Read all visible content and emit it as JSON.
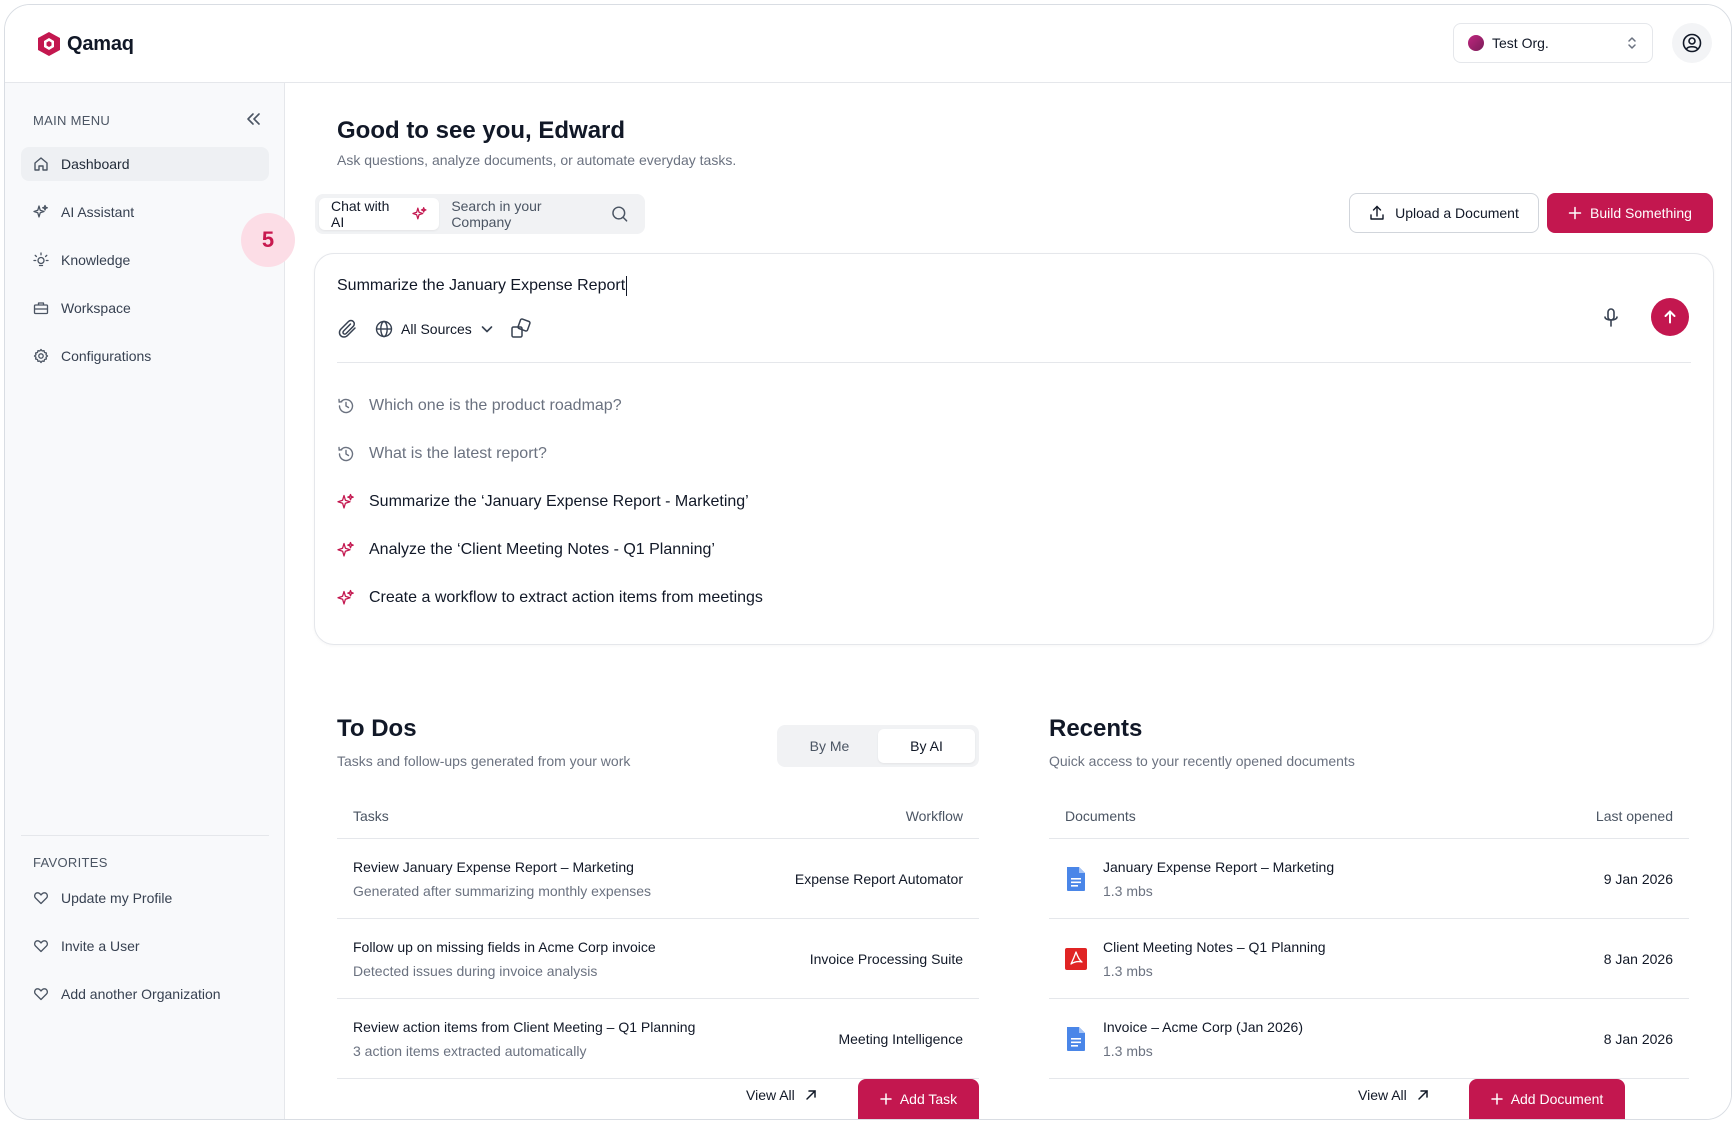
{
  "header": {
    "logo_text": "Qamaq",
    "org_name": "Test Org."
  },
  "sidebar": {
    "main_menu_title": "MAIN MENU",
    "items": [
      {
        "label": "Dashboard",
        "icon": "home-icon",
        "active": true
      },
      {
        "label": "AI Assistant",
        "icon": "sparkle-icon"
      },
      {
        "label": "Knowledge",
        "icon": "lightbulb-icon"
      },
      {
        "label": "Workspace",
        "icon": "briefcase-icon"
      },
      {
        "label": "Configurations",
        "icon": "gear-icon"
      }
    ],
    "badge": "5",
    "favorites_title": "FAVORITES",
    "favorites": [
      {
        "label": "Update my Profile",
        "icon": "heart-icon"
      },
      {
        "label": "Invite a User",
        "icon": "heart-icon"
      },
      {
        "label": "Add another Organization",
        "icon": "heart-icon"
      }
    ]
  },
  "main": {
    "greeting": "Good to see you, Edward",
    "subtitle": "Ask questions, analyze documents, or automate everyday tasks.",
    "mode_chat": "Chat with AI",
    "mode_search": "Search in your Company",
    "upload_label": "Upload a Document",
    "build_label": "Build Something",
    "chat_input": "Summarize the January Expense Report",
    "sources_label": "All Sources",
    "suggestions": [
      {
        "type": "history",
        "text": "Which one is the product roadmap?"
      },
      {
        "type": "history",
        "text": "What is the latest report?"
      },
      {
        "type": "ai",
        "text": "Summarize the ‘January Expense Report - Marketing’"
      },
      {
        "type": "ai",
        "text": "Analyze the ‘Client Meeting Notes - Q1 Planning’"
      },
      {
        "type": "ai",
        "text": "Create a workflow to extract action items from meetings"
      }
    ]
  },
  "todos": {
    "title": "To Dos",
    "subtitle": "Tasks and follow-ups generated from your work",
    "seg_by_me": "By Me",
    "seg_by_ai": "By AI",
    "col_tasks": "Tasks",
    "col_workflow": "Workflow",
    "rows": [
      {
        "title": "Review January Expense Report – Marketing",
        "sub": "Generated after summarizing monthly expenses",
        "workflow": "Expense Report Automator"
      },
      {
        "title": "Follow up on missing fields in Acme Corp invoice",
        "sub": "Detected issues during invoice analysis",
        "workflow": "Invoice Processing Suite"
      },
      {
        "title": "Review action items from Client Meeting – Q1 Planning",
        "sub": "3 action items extracted automatically",
        "workflow": "Meeting Intelligence"
      }
    ],
    "view_all": "View All",
    "add_label": "Add Task"
  },
  "recents": {
    "title": "Recents",
    "subtitle": "Quick access to your recently opened documents",
    "col_documents": "Documents",
    "col_last_opened": "Last opened",
    "rows": [
      {
        "title": "January Expense Report – Marketing",
        "sub": "1.3 mbs",
        "date": "9 Jan 2026",
        "icon": "google-doc-icon"
      },
      {
        "title": "Client Meeting Notes – Q1 Planning",
        "sub": "1.3 mbs",
        "date": "8 Jan 2026",
        "icon": "pdf-icon"
      },
      {
        "title": "Invoice – Acme Corp (Jan 2026)",
        "sub": "1.3 mbs",
        "date": "8 Jan 2026",
        "icon": "google-doc-icon"
      }
    ],
    "view_all": "View All",
    "add_label": "Add Document"
  },
  "colors": {
    "accent": "#c3174f",
    "badge_bg": "#fcdde6"
  }
}
